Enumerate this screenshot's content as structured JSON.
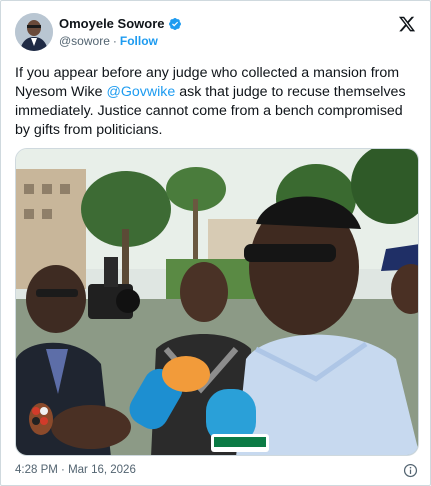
{
  "author": {
    "display_name": "Omoyele Sowore",
    "handle": "@sowore",
    "separator": "·",
    "follow_label": "Follow",
    "verified": true
  },
  "tweet": {
    "text_before": "If you appear before any judge who collected a mansion from Nyesom Wike ",
    "mention": "@Govwike",
    "text_after": " ask that judge to recuse themselves immediately. Justice cannot come from a bench compromised by gifts from politicians."
  },
  "media": {
    "icon": "photo-icon"
  },
  "footer": {
    "time": "4:28 PM",
    "separator": "·",
    "date": "Mar 16, 2026"
  },
  "colors": {
    "accent": "#1d9bf0",
    "text": "#0f1419",
    "muted": "#536471",
    "border": "#cfd9de"
  }
}
